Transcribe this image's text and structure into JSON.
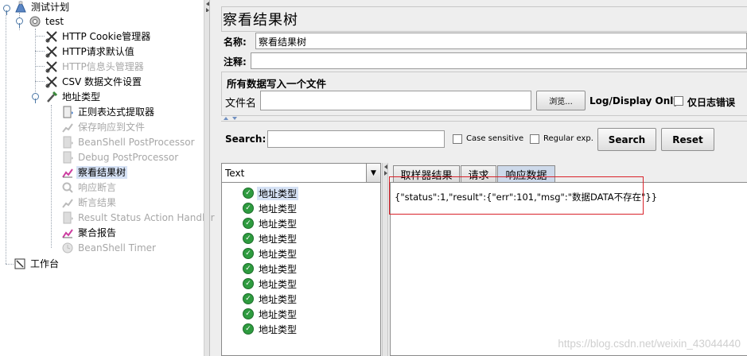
{
  "tree": {
    "items": [
      {
        "label": "测试计划",
        "icon": "test-plan-icon"
      },
      {
        "label": "test",
        "icon": "thread-group-gear-icon"
      },
      {
        "label": "HTTP Cookie管理器",
        "icon": "wrench-scissors-icon"
      },
      {
        "label": "HTTP请求默认值",
        "icon": "wrench-scissors-icon"
      },
      {
        "label": "HTTP信息头管理器",
        "icon": "wrench-scissors-icon"
      },
      {
        "label": "CSV 数据文件设置",
        "icon": "wrench-scissors-icon"
      },
      {
        "label": "地址类型",
        "icon": "sampler-pipette-icon"
      },
      {
        "label": "正则表达式提取器",
        "icon": "post-processor-icon"
      },
      {
        "label": "保存响应到文件",
        "icon": "listener-chart-icon"
      },
      {
        "label": "BeanShell PostProcessor",
        "icon": "post-processor-icon"
      },
      {
        "label": "Debug PostProcessor",
        "icon": "post-processor-icon"
      },
      {
        "label": "察看结果树",
        "icon": "listener-chart-icon"
      },
      {
        "label": "响应断言",
        "icon": "assertion-magnifier-icon"
      },
      {
        "label": "断言结果",
        "icon": "listener-chart-icon"
      },
      {
        "label": "Result Status Action Handler",
        "icon": "post-processor-icon"
      },
      {
        "label": "聚合报告",
        "icon": "listener-chart-icon"
      },
      {
        "label": "BeanShell Timer",
        "icon": "timer-clock-icon"
      },
      {
        "label": "工作台",
        "icon": "workbench-icon"
      }
    ]
  },
  "panel": {
    "title": "察看结果树",
    "name_label": "名称:",
    "name_value": "察看结果树",
    "comment_label": "注释:",
    "comment_value": "",
    "file_group_title": "所有数据写入一个文件",
    "filename_label": "文件名",
    "filename_value": "",
    "browse_button": "浏览...",
    "log_display_label": "Log/Display Only:",
    "errors_only_label": "仅日志错误"
  },
  "search": {
    "label": "Search:",
    "value": "",
    "case_sensitive_label": "Case sensitive",
    "regex_label": "Regular exp.",
    "search_button": "Search",
    "reset_button": "Reset"
  },
  "results": {
    "renderer_value": "Text",
    "samples": [
      "地址类型",
      "地址类型",
      "地址类型",
      "地址类型",
      "地址类型",
      "地址类型",
      "地址类型",
      "地址类型",
      "地址类型",
      "地址类型"
    ],
    "tabs": [
      "取样器结果",
      "请求",
      "响应数据"
    ],
    "active_tab": "响应数据",
    "response_text": "{\"status\":1,\"result\":{\"err\":101,\"msg\":\"数据DATA不存在\"}}"
  },
  "watermark": "https://blog.csdn.net/weixin_43044440",
  "colors": {
    "selection": "#d6e2f5",
    "success_icon": "#2e9b3f",
    "highlight_box": "#d9222a",
    "active_tab": "#cdd9ea"
  }
}
